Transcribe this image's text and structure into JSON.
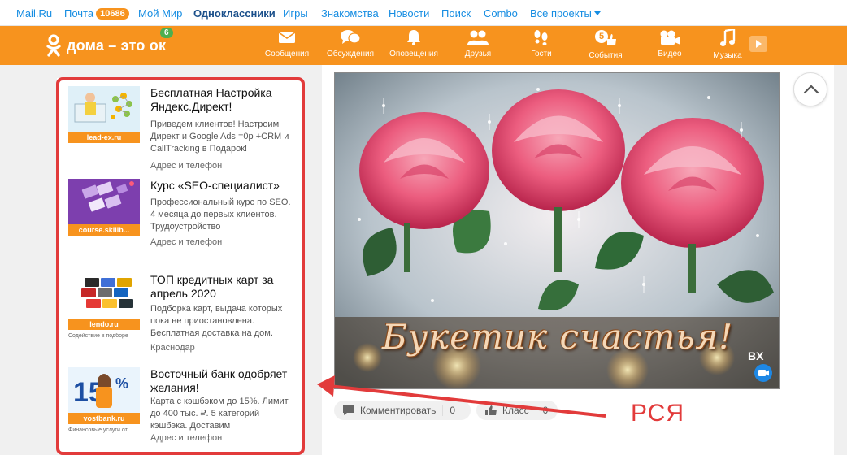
{
  "topbar": {
    "items": [
      "Mail.Ru",
      "Почта",
      "Мой Мир",
      "Одноклассники",
      "Игры",
      "Знакомства",
      "Новости",
      "Поиск",
      "Combo",
      "Все проекты"
    ],
    "mail_badge": "10686"
  },
  "ok_header": {
    "logo_text": "дома – это ок",
    "logo_badge": "6",
    "nav": [
      "Сообщения",
      "Обсуждения",
      "Оповещения",
      "Друзья",
      "Гости",
      "События",
      "Видео",
      "Музыка"
    ],
    "events_badge": "5"
  },
  "ads": [
    {
      "title": "Бесплатная Настройка Яндекс.Директ!",
      "desc": "Приведем клиентов! Настроим Директ и Google Ads =0р +CRM и CallTracking в Подарок!",
      "addr": "Адрес и телефон",
      "domain": "lead-ex.ru",
      "sub": ""
    },
    {
      "title": "Курс «SEO-специалист»",
      "desc": "Профессиональный курс по SEO. 4 месяца до первых клиентов. Трудоустройство",
      "addr": "Адрес и телефон",
      "domain": "course.skillb...",
      "sub": ""
    },
    {
      "title": "ТОП кредитных карт за апрель 2020",
      "desc": "Подборка карт, выдача которых пока не приостановлена. Бесплатная доставка на дом.",
      "addr": "Краснодар",
      "domain": "lendo.ru",
      "sub": "Содействие в подборе"
    },
    {
      "title": "Восточный банк одобряет желания!",
      "desc": "Карта с кэшбэком до 15%. Лимит до 400 тыс. ₽. 5 категорий кэшбэка. Доставим",
      "addr": "Адрес и телефон",
      "domain": "vostbank.ru",
      "sub": "Финансовые услуги от"
    }
  ],
  "post": {
    "image_caption": "Букетик счастья!",
    "watermark": "BX",
    "comment_label": "Комментировать",
    "comment_count": "0",
    "like_label": "Класс",
    "like_count": "0"
  },
  "annotation": {
    "label": "РСЯ",
    "color": "#e23b3b"
  },
  "colors": {
    "ok_orange": "#f7931e",
    "link_blue": "#168de2",
    "annotation_red": "#e23b3b"
  }
}
